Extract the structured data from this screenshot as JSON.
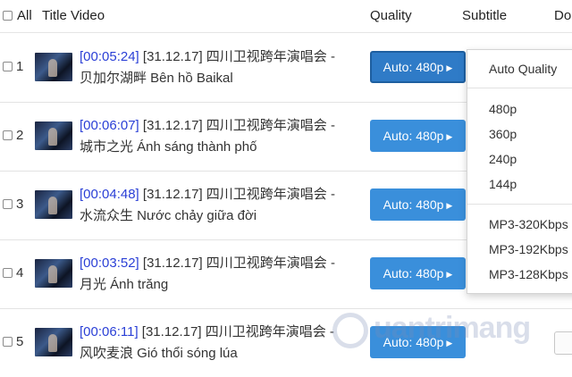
{
  "header": {
    "select_all_label": "All",
    "title_col": "Title Video",
    "quality_col": "Quality",
    "subtitle_col": "Subtitle",
    "download_col": "Do"
  },
  "rows": [
    {
      "index": "1",
      "duration": "[00:05:24]",
      "title_line1": "[31.12.17] 四川卫视跨年演唱会 -",
      "title_line2": "贝加尔湖畔 Bên hồ Baikal",
      "quality": "Auto: 480p"
    },
    {
      "index": "2",
      "duration": "[00:06:07]",
      "title_line1": "[31.12.17] 四川卫视跨年演唱会 -",
      "title_line2": "城市之光 Ánh sáng thành phố",
      "quality": "Auto: 480p"
    },
    {
      "index": "3",
      "duration": "[00:04:48]",
      "title_line1": "[31.12.17] 四川卫视跨年演唱会 -",
      "title_line2": "水流众生 Nước chảy giữa đời",
      "quality": "Auto: 480p"
    },
    {
      "index": "4",
      "duration": "[00:03:52]",
      "title_line1": "[31.12.17] 四川卫视跨年演唱会 -",
      "title_line2": "月光 Ánh trăng",
      "quality": "Auto: 480p"
    },
    {
      "index": "5",
      "duration": "[00:06:11]",
      "title_line1": "[31.12.17] 四川卫视跨年演唱会 -",
      "title_line2": "风吹麦浪 Gió thổi sóng lúa",
      "quality": "Auto: 480p"
    }
  ],
  "quality_menu": {
    "items": [
      "Auto Quality",
      "480p",
      "360p",
      "240p",
      "144p",
      "MP3-320Kbps",
      "MP3-192Kbps",
      "MP3-128Kbps"
    ]
  },
  "watermark": {
    "text": "uantrimang"
  },
  "colors": {
    "button": "#3a8fdb",
    "duration": "#2a3fd6"
  }
}
